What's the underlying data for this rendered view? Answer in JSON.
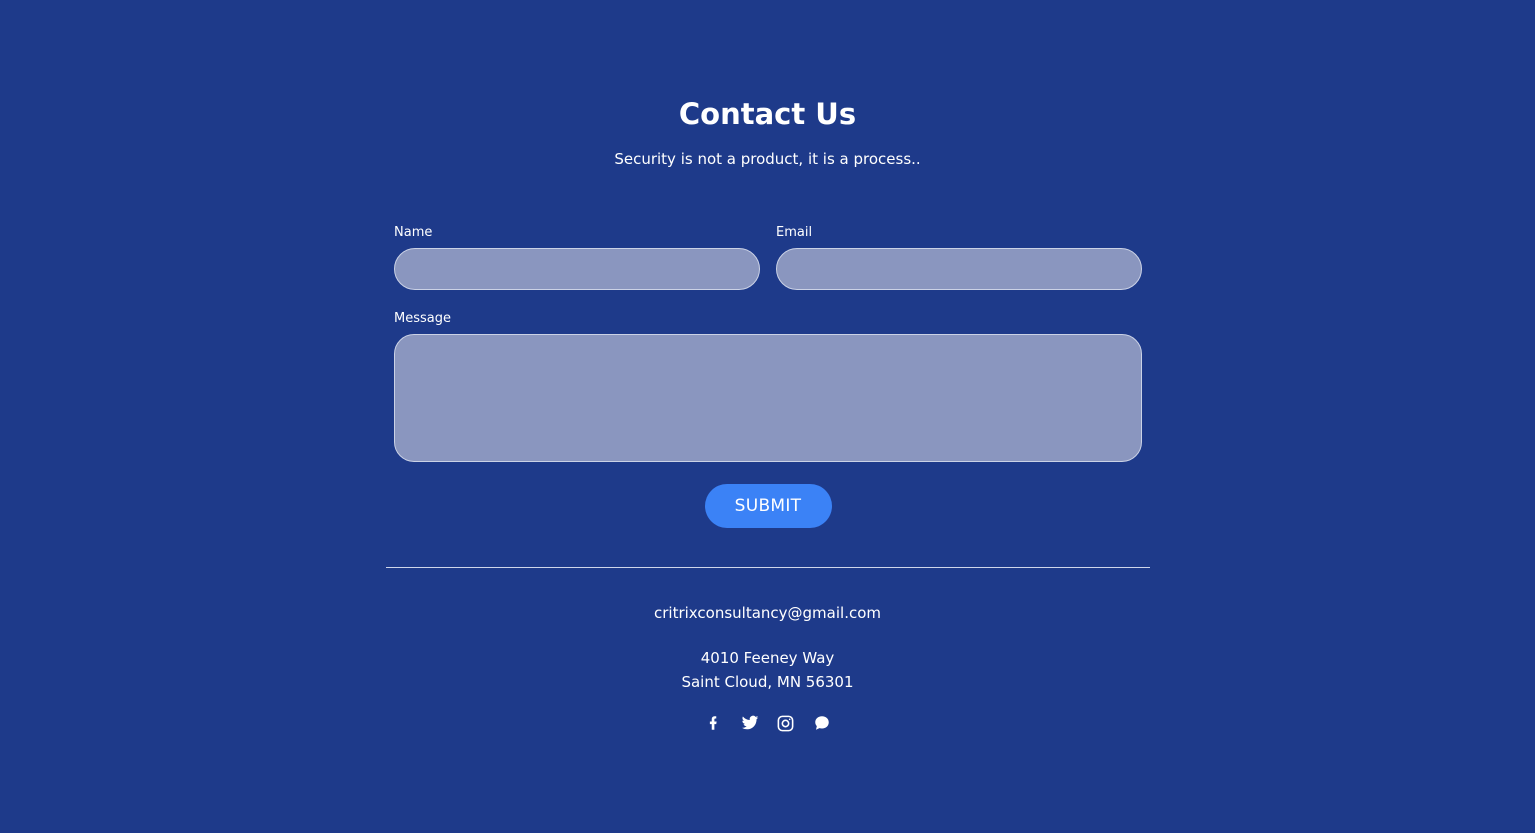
{
  "header": {
    "title": "Contact Us",
    "subtitle": "Security is not a product, it is a process.."
  },
  "form": {
    "name_label": "Name",
    "name_value": "",
    "email_label": "Email",
    "email_value": "",
    "message_label": "Message",
    "message_value": "",
    "submit_label": "SUBMIT"
  },
  "footer": {
    "email": "critrixconsultancy@gmail.com",
    "address_line1": "4010 Feeney Way",
    "address_line2": "Saint Cloud, MN 56301",
    "socials": [
      "facebook-icon",
      "twitter-icon",
      "instagram-icon",
      "chat-icon"
    ]
  },
  "colors": {
    "background": "#1e3a8a",
    "input_fill": "#8a96bf",
    "button": "#3b82f6",
    "text": "#ffffff"
  }
}
